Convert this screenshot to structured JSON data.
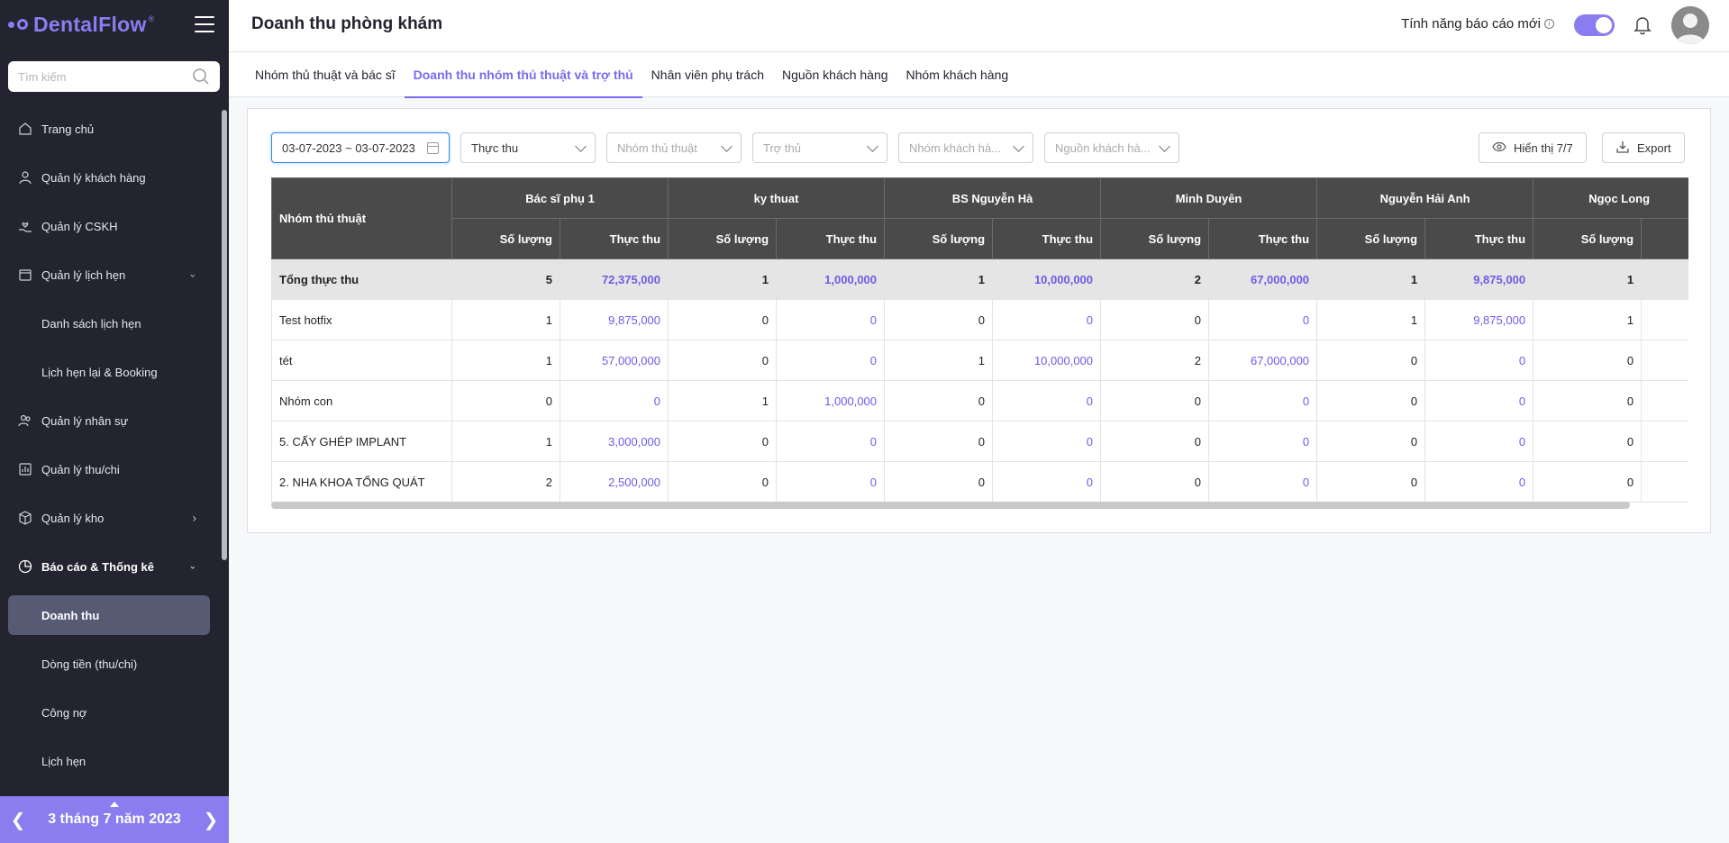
{
  "app": {
    "name": "DentalFlow",
    "trademark": "®"
  },
  "search": {
    "placeholder": "Tìm kiếm"
  },
  "nav": [
    {
      "label": "Trang chủ",
      "icon": "home-icon"
    },
    {
      "label": "Quản lý khách hàng",
      "icon": "user-icon"
    },
    {
      "label": "Quản lý CSKH",
      "icon": "hand-heart-icon"
    },
    {
      "label": "Quản lý lịch hẹn",
      "icon": "calendar-icon",
      "chevron": "down"
    },
    {
      "label": "Danh sách lịch hẹn",
      "sub": true
    },
    {
      "label": "Lịch hẹn lại & Booking",
      "sub": true
    },
    {
      "label": "Quản lý nhân sự",
      "icon": "users-icon"
    },
    {
      "label": "Quản lý thu/chi",
      "icon": "chart-bar-icon"
    },
    {
      "label": "Quản lý kho",
      "icon": "box-icon",
      "chevron": "right"
    },
    {
      "label": "Báo cáo & Thống kê",
      "icon": "pie-chart-icon",
      "chevron": "down",
      "bold": true
    },
    {
      "label": "Doanh thu",
      "sub": true,
      "active": true
    },
    {
      "label": "Dòng tiền (thu/chi)",
      "sub": true
    },
    {
      "label": "Công nợ",
      "sub": true
    },
    {
      "label": "Lịch hẹn",
      "sub": true
    }
  ],
  "datebar": {
    "label": "3 tháng 7 năm 2023"
  },
  "header": {
    "title": "Doanh thu phòng khám",
    "feature_label": "Tính năng báo cáo mới",
    "toggle_on": true
  },
  "tabs": [
    {
      "label": "Nhóm thủ thuật và bác sĩ"
    },
    {
      "label": "Doanh thu nhóm thủ thuật và trợ thủ",
      "active": true
    },
    {
      "label": "Nhân viên phụ trách"
    },
    {
      "label": "Nguồn khách hàng"
    },
    {
      "label": "Nhóm khách hàng"
    }
  ],
  "filters": {
    "date_range": "03-07-2023 ~ 03-07-2023",
    "revenue_type": "Thực thu",
    "procedure_group_ph": "Nhóm thủ thuật",
    "assistant_ph": "Trợ thủ",
    "customer_group_ph": "Nhóm khách hà...",
    "customer_source_ph": "Nguồn khách hà..."
  },
  "buttons": {
    "show": "Hiển thị 7/7",
    "export": "Export"
  },
  "table": {
    "first_col": "Nhóm thủ thuật",
    "sub_qty": "Số lượng",
    "sub_rev": "Thực thu",
    "groups": [
      "Bác sĩ phụ 1",
      "ky thuat",
      "BS Nguyễn Hà",
      "Minh Duyên",
      "Nguyễn Hải Anh",
      "Ngọc Long"
    ],
    "rows": [
      {
        "name": "Tổng thực thu",
        "total": true,
        "cells": [
          "5",
          "72,375,000",
          "1",
          "1,000,000",
          "1",
          "10,000,000",
          "2",
          "67,000,000",
          "1",
          "9,875,000",
          "1"
        ]
      },
      {
        "name": "Test hotfix",
        "cells": [
          "1",
          "9,875,000",
          "0",
          "0",
          "0",
          "0",
          "0",
          "0",
          "1",
          "9,875,000",
          "1"
        ]
      },
      {
        "name": "tét",
        "cells": [
          "1",
          "57,000,000",
          "0",
          "0",
          "1",
          "10,000,000",
          "2",
          "67,000,000",
          "0",
          "0",
          "0"
        ]
      },
      {
        "name": "Nhóm con",
        "cells": [
          "0",
          "0",
          "1",
          "1,000,000",
          "0",
          "0",
          "0",
          "0",
          "0",
          "0",
          "0"
        ]
      },
      {
        "name": "5. CẤY GHÉP IMPLANT",
        "cells": [
          "1",
          "3,000,000",
          "0",
          "0",
          "0",
          "0",
          "0",
          "0",
          "0",
          "0",
          "0"
        ]
      },
      {
        "name": "2. NHA KHOA TỔNG QUÁT",
        "cells": [
          "2",
          "2,500,000",
          "0",
          "0",
          "0",
          "0",
          "0",
          "0",
          "0",
          "0",
          "0"
        ]
      }
    ]
  },
  "colors": {
    "accent": "#8b7cf0",
    "sidebar_bg": "#23242f",
    "active_nav": "#565a72",
    "money": "#6c5ce7",
    "header_bg": "#4a4a4a"
  }
}
